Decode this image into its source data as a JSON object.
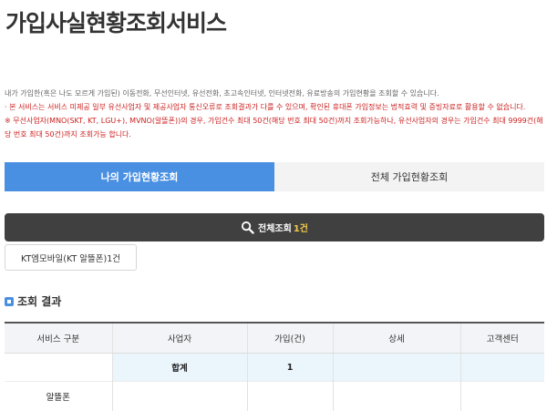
{
  "page": {
    "title": "가입사실현황조회서비스",
    "description": [
      "내가 가입한(혹은 나도 모르게 가입된) 이동전화, 무선인터넷, 유선전화, 초고속인터넷, 인터넷전화, 유료방송의 가입현황을 조회할 수 있습니다.",
      "· 본 서비스는 서비스 미제공 일부 유선사업자 및 제공사업자 통신오류로 조회결과가 다를 수 있으며, 확인된 휴대폰 가입정보는 법적효력 및 증빙자료로 활용할 수 없습니다.",
      "※ 무선사업자(MNO(SKT, KT, LGU+), MVNO(알뜰폰))의 경우, 가입건수 최대 50건(해당 번호 최대 50건)까지 조회가능하나, 유선사업자의 경우는 가입건수 최대 9999건(해당 번호 최대 50건)까지 조회가능 합니다."
    ]
  },
  "tabs": [
    {
      "label": "나의 가입현황조회",
      "active": true
    },
    {
      "label": "전체 가입현황조회",
      "active": false
    }
  ],
  "summary_bar": {
    "icon": "search-icon",
    "label": "전체조회",
    "count": "1건"
  },
  "provider_chip": {
    "label": "KT엠모바일(KT 알뜰폰)1건"
  },
  "section": {
    "icon": "section-bullet-icon",
    "title": "조회 결과"
  },
  "table": {
    "headers": [
      "서비스 구분",
      "사업자",
      "가입(건)",
      "상세",
      "고객센터"
    ],
    "total_row": {
      "label": "합계",
      "count": "1"
    },
    "rows": [
      {
        "service": "알뜰폰",
        "provider": "",
        "count": "",
        "detail": "",
        "support": ""
      }
    ]
  },
  "colors": {
    "accent": "#4a90e2",
    "bar": "#404040",
    "highlight": "#f2c94c",
    "warning_text": "#cc1f1f"
  }
}
